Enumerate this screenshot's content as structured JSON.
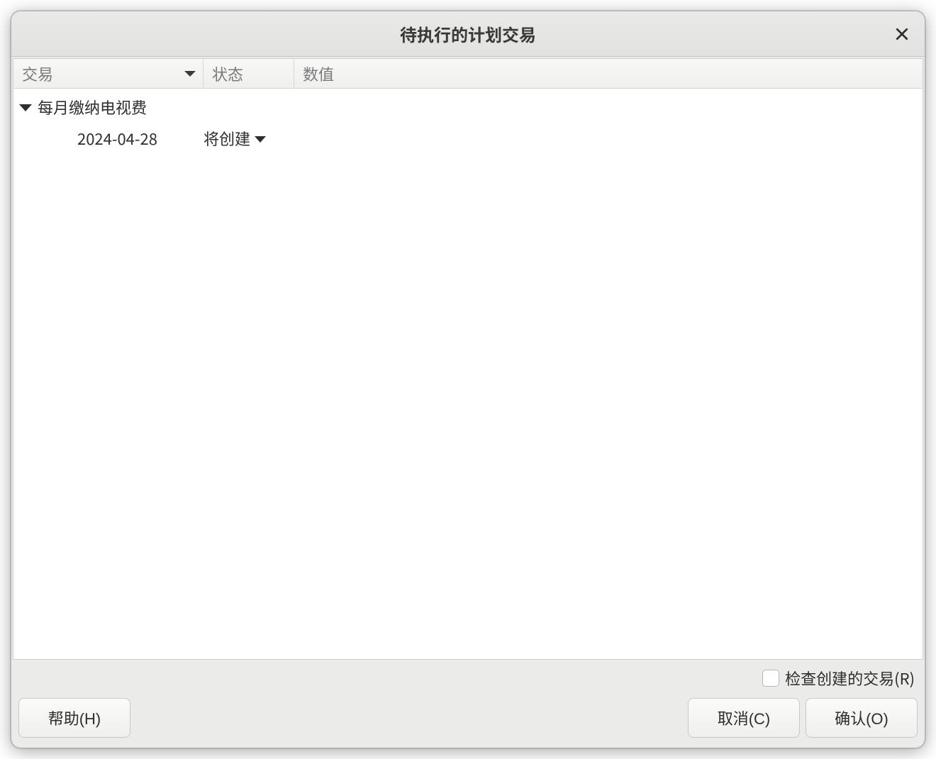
{
  "titlebar": {
    "title": "待执行的计划交易"
  },
  "columns": {
    "col0": "交易",
    "col1": "状态",
    "col2": "数值"
  },
  "groups": [
    {
      "name": "每月缴纳电视费",
      "expanded": true,
      "children": [
        {
          "date": "2024-04-28",
          "status": "将创建",
          "value": ""
        }
      ]
    }
  ],
  "footer": {
    "checkbox_label": "检查创建的交易(R)",
    "checkbox_checked": false,
    "help": "帮助(H)",
    "cancel": "取消(C)",
    "ok": "确认(O)"
  }
}
